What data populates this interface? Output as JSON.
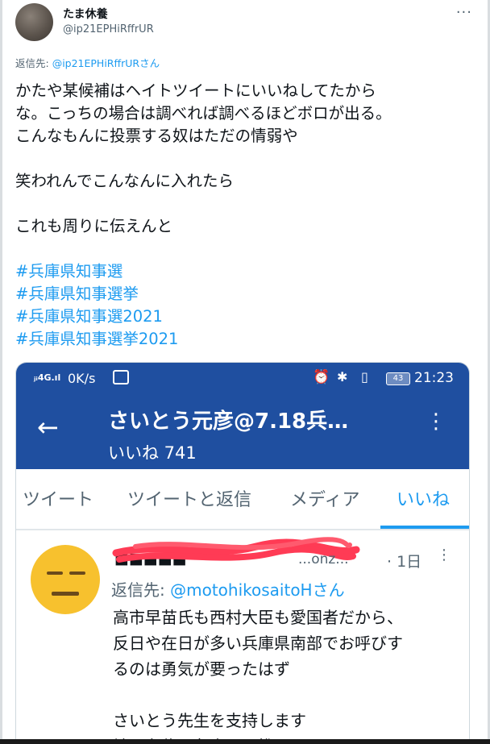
{
  "tweet": {
    "author_name": "たま休養",
    "author_handle": "@ip21EPHiRffrUR",
    "more_icon": "ellipsis-icon",
    "reply_prefix": "返信先: ",
    "reply_handle": "@ip21EPHiRffrUR",
    "reply_suffix": "さん",
    "lines": [
      "かたや某候補はヘイトツイートにいいねしてたから",
      "な。こっちの場合は調べれば調べるほどボロが出る。",
      "こんなもんに投票する奴はただの情弱や",
      "",
      "笑われんでこんなんに入れたら",
      "",
      "これも周りに伝えんと",
      ""
    ],
    "hashtags": [
      "#兵庫県知事選",
      "#兵庫県知事選挙",
      "#兵庫県知事選2021",
      "#兵庫県知事選挙2021"
    ]
  },
  "screenshot": {
    "status_bar": {
      "signal": "ⱼᵢ4G.ıl",
      "speed": "0K/s",
      "battery": "43",
      "time": "21:23"
    },
    "app_bar": {
      "title": "さいとう元彦@7.18兵…",
      "subtitle": "いいね 741"
    },
    "tabs": [
      "ツイート",
      "ツイートと返信",
      "メディア",
      "いいね"
    ],
    "active_tab": "いいね",
    "inner_tweet": {
      "name": "■■■■■",
      "handle": "...onz...",
      "time": "· 1日",
      "reply_prefix": "返信先: ",
      "reply_handle": "@motohikosaitoH",
      "reply_suffix": "さん",
      "lines": [
        "高市早苗氏も西村大臣も愛国者だから、",
        "反日や在日が多い兵庫県南部でお呼びす",
        "るのは勇気が要ったはず",
        "",
        "さいとう先生を支持します",
        "神戸在住の友人にも推しておきます"
      ]
    }
  },
  "colors": {
    "link": "#1d9bf0",
    "app_bar": "#1f4fa0",
    "emoji": "#f7c12e",
    "scribble": "#ff3b55"
  }
}
